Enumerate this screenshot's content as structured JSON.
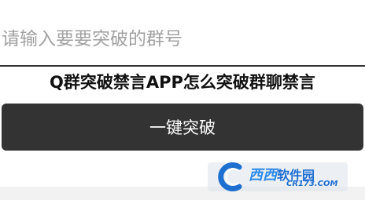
{
  "search": {
    "placeholder": "请输入要要突破的群号",
    "value": ""
  },
  "headline": "Q群突破禁言APP怎么突破群聊禁言",
  "action_button": {
    "label": "一键突破"
  },
  "watermark": {
    "brand_main": "西西",
    "brand_sub": "软件园",
    "url": "CR173.COM",
    "icon": "c-logo-icon"
  },
  "colors": {
    "button_background": "#333333",
    "button_text": "#ffffff",
    "placeholder": "#a2a2a2",
    "underline": "#333333",
    "headline": "#111111",
    "footer_background": "#f2f2f2",
    "watermark_blue": "#1e6fd0"
  }
}
